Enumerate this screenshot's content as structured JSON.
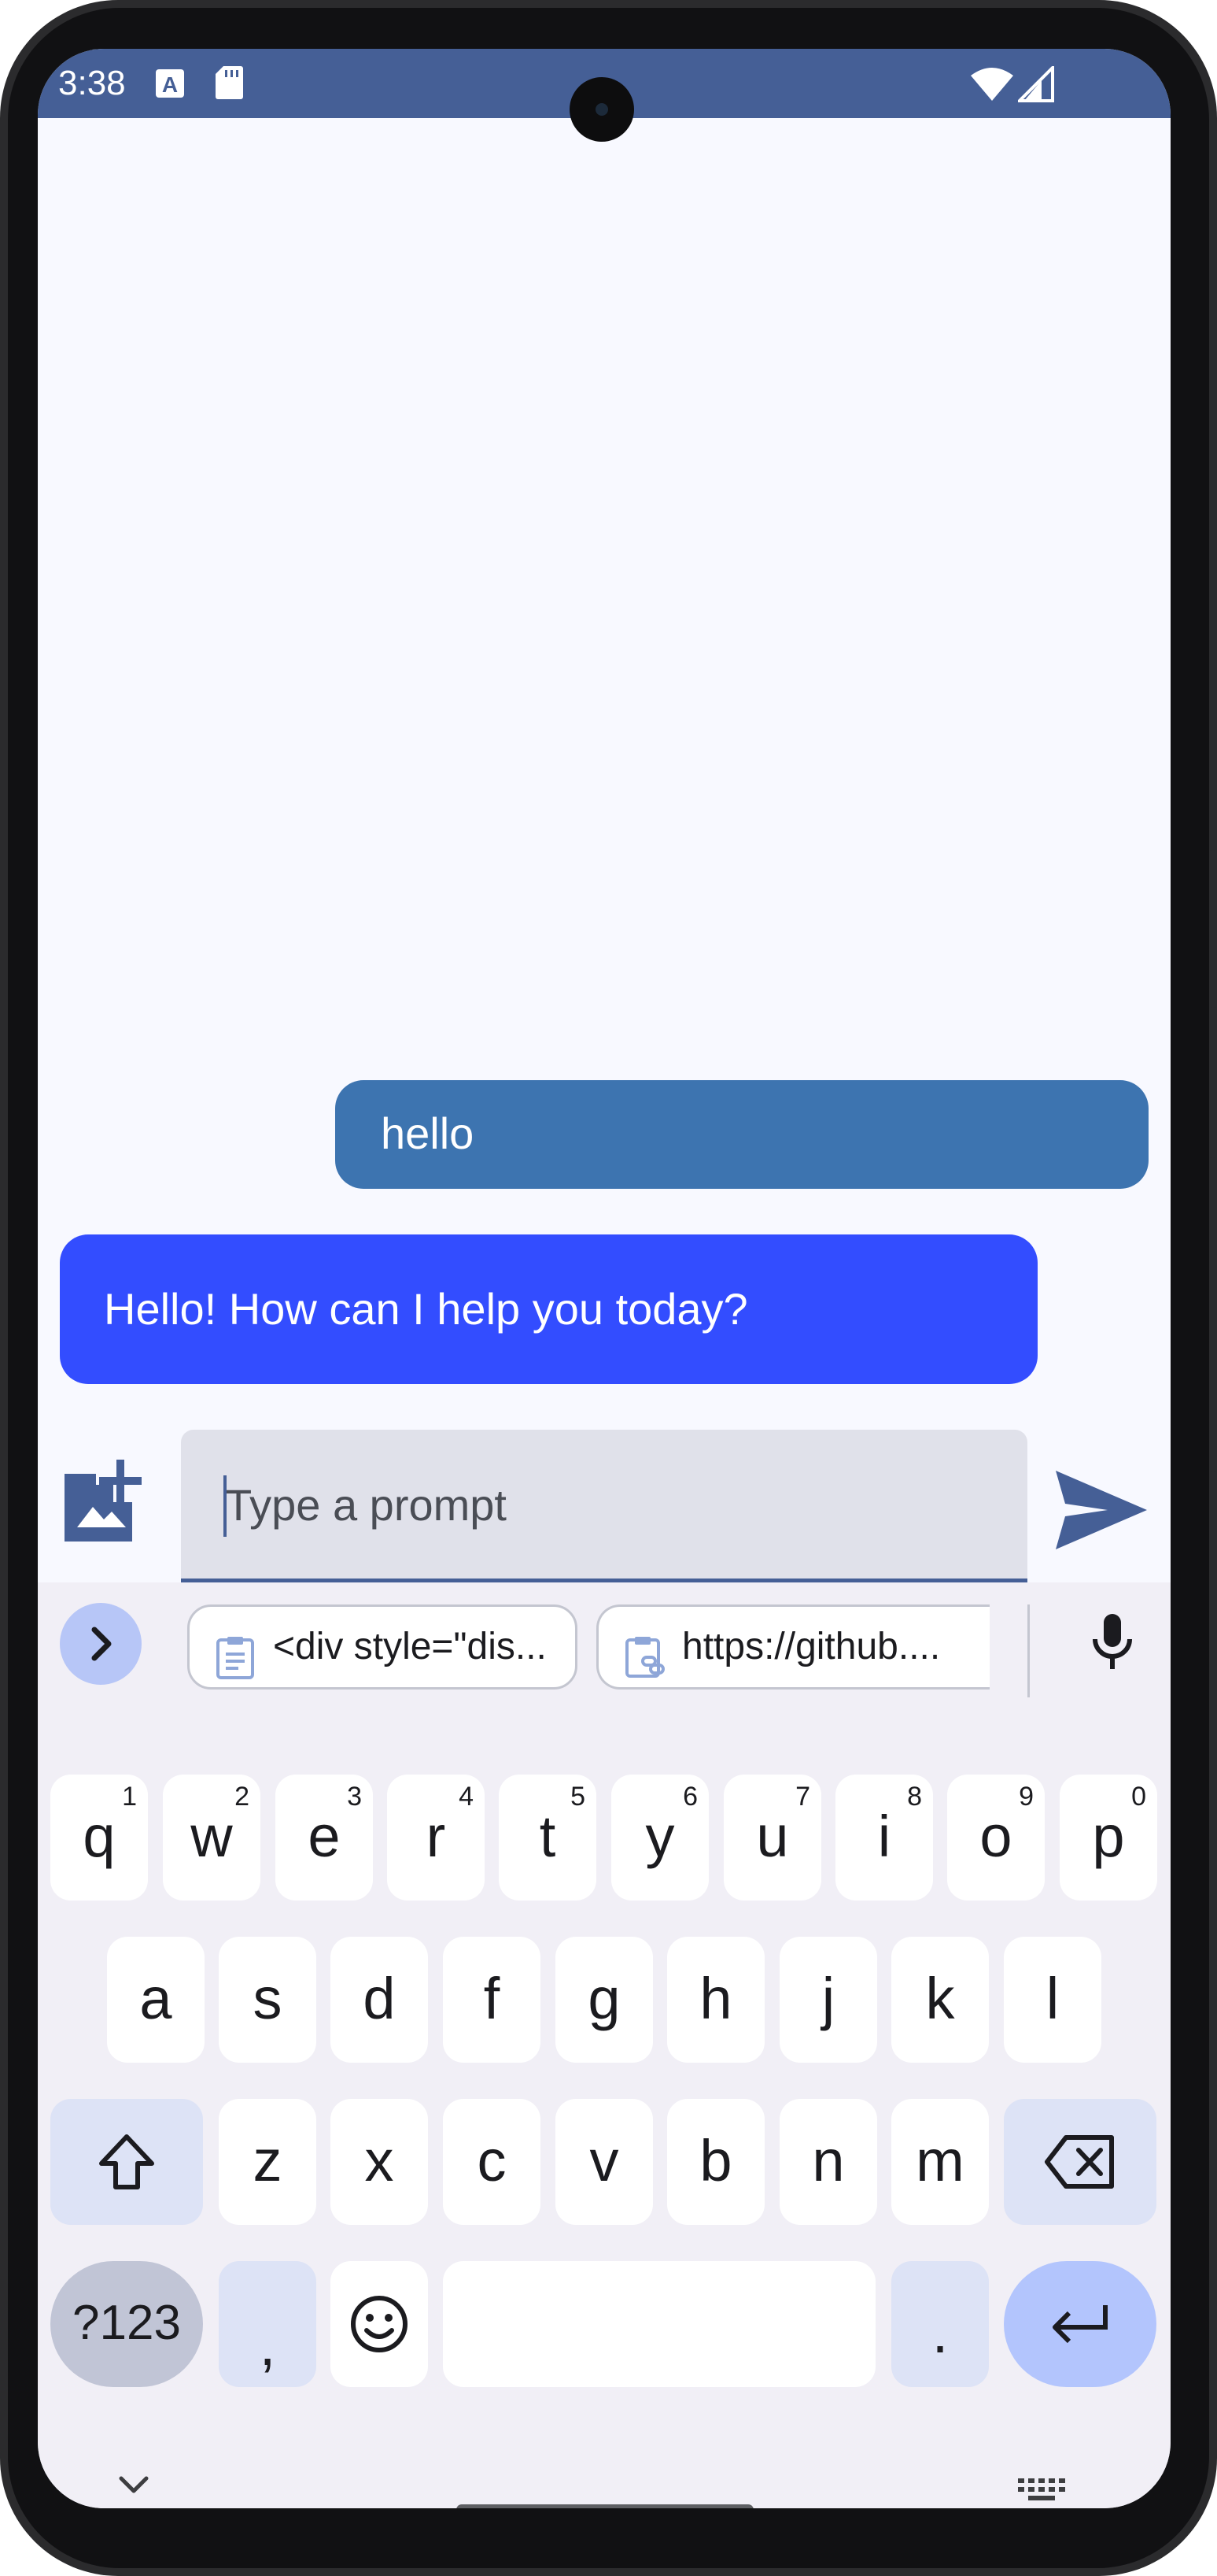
{
  "status_bar": {
    "time": "3:38",
    "icons": [
      "text-a-icon",
      "sd-card-icon",
      "wifi-icon",
      "signal-icon"
    ],
    "color": "#455f96"
  },
  "messages": [
    {
      "role": "user",
      "text": "hello",
      "color": "#3d74b0"
    },
    {
      "role": "assistant",
      "text": "Hello! How can I help you today?",
      "color": "#334dff"
    }
  ],
  "composer": {
    "placeholder": "Type a prompt",
    "value": "",
    "add_image_icon": "add-photo-icon",
    "send_icon": "send-icon"
  },
  "keyboard": {
    "suggestion_chips": [
      {
        "icon": "clipboard-icon",
        "text": "<div style=\"dis..."
      },
      {
        "icon": "clipboard-link-icon",
        "text": "https://github...."
      }
    ],
    "rows": [
      [
        {
          "k": "q",
          "n": "1"
        },
        {
          "k": "w",
          "n": "2"
        },
        {
          "k": "e",
          "n": "3"
        },
        {
          "k": "r",
          "n": "4"
        },
        {
          "k": "t",
          "n": "5"
        },
        {
          "k": "y",
          "n": "6"
        },
        {
          "k": "u",
          "n": "7"
        },
        {
          "k": "i",
          "n": "8"
        },
        {
          "k": "o",
          "n": "9"
        },
        {
          "k": "p",
          "n": "0"
        }
      ],
      [
        {
          "k": "a"
        },
        {
          "k": "s"
        },
        {
          "k": "d"
        },
        {
          "k": "f"
        },
        {
          "k": "g"
        },
        {
          "k": "h"
        },
        {
          "k": "j"
        },
        {
          "k": "k"
        },
        {
          "k": "l"
        }
      ],
      [
        {
          "k": "z"
        },
        {
          "k": "x"
        },
        {
          "k": "c"
        },
        {
          "k": "v"
        },
        {
          "k": "b"
        },
        {
          "k": "n"
        },
        {
          "k": "m"
        }
      ]
    ],
    "symbols_key": "?123",
    "comma_key": ",",
    "period_key": ".",
    "accent_color": "#b3c5fd"
  }
}
